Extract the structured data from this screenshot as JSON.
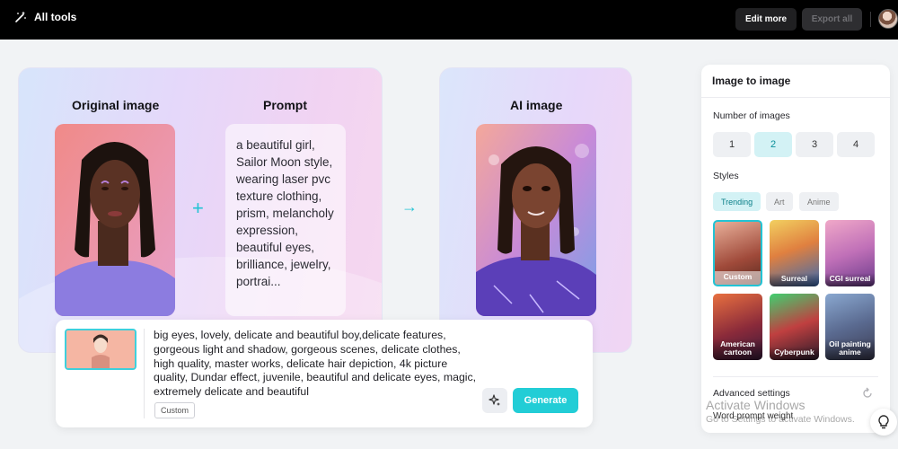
{
  "topbar": {
    "all_tools_label": "All tools",
    "edit_more_label": "Edit more",
    "export_all_label": "Export all"
  },
  "original": {
    "title": "Original image"
  },
  "prompt_card": {
    "title": "Prompt",
    "text": "a beautiful girl, Sailor Moon style, wearing laser pvc texture clothing, prism, melancholy expression, beautiful eyes, brilliance, jewelry, portrai..."
  },
  "ai": {
    "title": "AI image"
  },
  "prompt_panel": {
    "text": "big eyes, lovely, delicate and beautiful boy,delicate features, gorgeous light and shadow, gorgeous scenes, delicate clothes, high quality, master works, delicate hair depiction, 4k picture quality, Dundar effect, juvenile, beautiful and delicate eyes, magic, extremely delicate and beautiful",
    "tag": "Custom",
    "generate_label": "Generate"
  },
  "right_panel": {
    "title": "Image to image",
    "num_images_label": "Number of images",
    "num_options": [
      "1",
      "2",
      "3",
      "4"
    ],
    "num_selected": "2",
    "styles_label": "Styles",
    "style_tabs": [
      "Trending",
      "Art",
      "Anime"
    ],
    "style_tab_selected": "Trending",
    "styles": [
      "Custom",
      "Surreal",
      "CGI surreal",
      "American cartoon",
      "Cyberpunk",
      "Oil painting anime"
    ],
    "style_selected": "Custom",
    "advanced_label": "Advanced settings",
    "word_weight_label": "Word prompt weight"
  },
  "watermark": {
    "line1": "Activate Windows",
    "line2": "Go to Settings to activate Windows."
  },
  "colors": {
    "accent": "#22cdd6",
    "topbar": "#000000"
  }
}
